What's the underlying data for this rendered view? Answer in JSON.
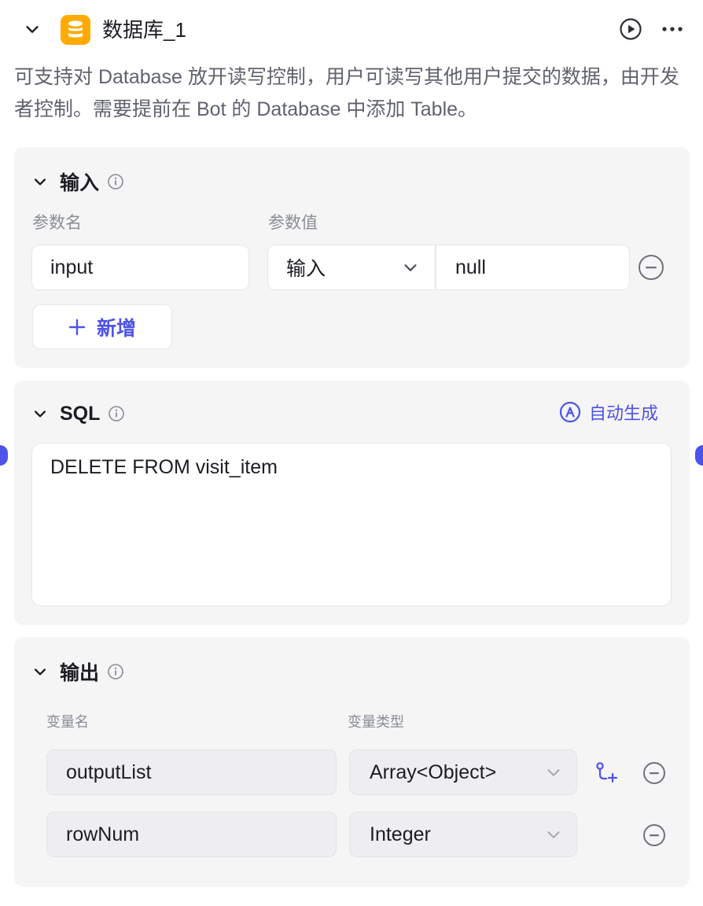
{
  "node": {
    "title": "数据库_1",
    "description": "可支持对 Database 放开读写控制，用户可读写其他用户提交的数据，由开发者控制。需要提前在 Bot 的 Database 中添加 Table。"
  },
  "input_section": {
    "title": "输入",
    "param_name_label": "参数名",
    "param_value_label": "参数值",
    "params": [
      {
        "name": "input",
        "source": "输入",
        "value": "null"
      }
    ],
    "add_label": "新增"
  },
  "sql_section": {
    "title": "SQL",
    "auto_generate_label": "自动生成",
    "statement": "DELETE FROM visit_item"
  },
  "output_section": {
    "title": "输出",
    "var_name_label": "变量名",
    "var_type_label": "变量类型",
    "vars": [
      {
        "name": "outputList",
        "type": "Array<Object>"
      },
      {
        "name": "rowNum",
        "type": "Integer"
      }
    ]
  },
  "colors": {
    "accent": "#4d53e8",
    "db_icon": "#ffaa00",
    "card_bg": "#f5f5f6",
    "text": "#1c1d23",
    "muted": "#8a8d96"
  },
  "icons": {
    "collapse": "chevron-down-icon",
    "db": "database-icon",
    "run": "play-circle-icon",
    "more": "more-horizontal-icon",
    "info": "info-icon",
    "remove": "minus-circle-icon",
    "add": "plus-icon",
    "auto_generate": "ai-circle-icon",
    "add_child": "add-subfield-icon"
  }
}
